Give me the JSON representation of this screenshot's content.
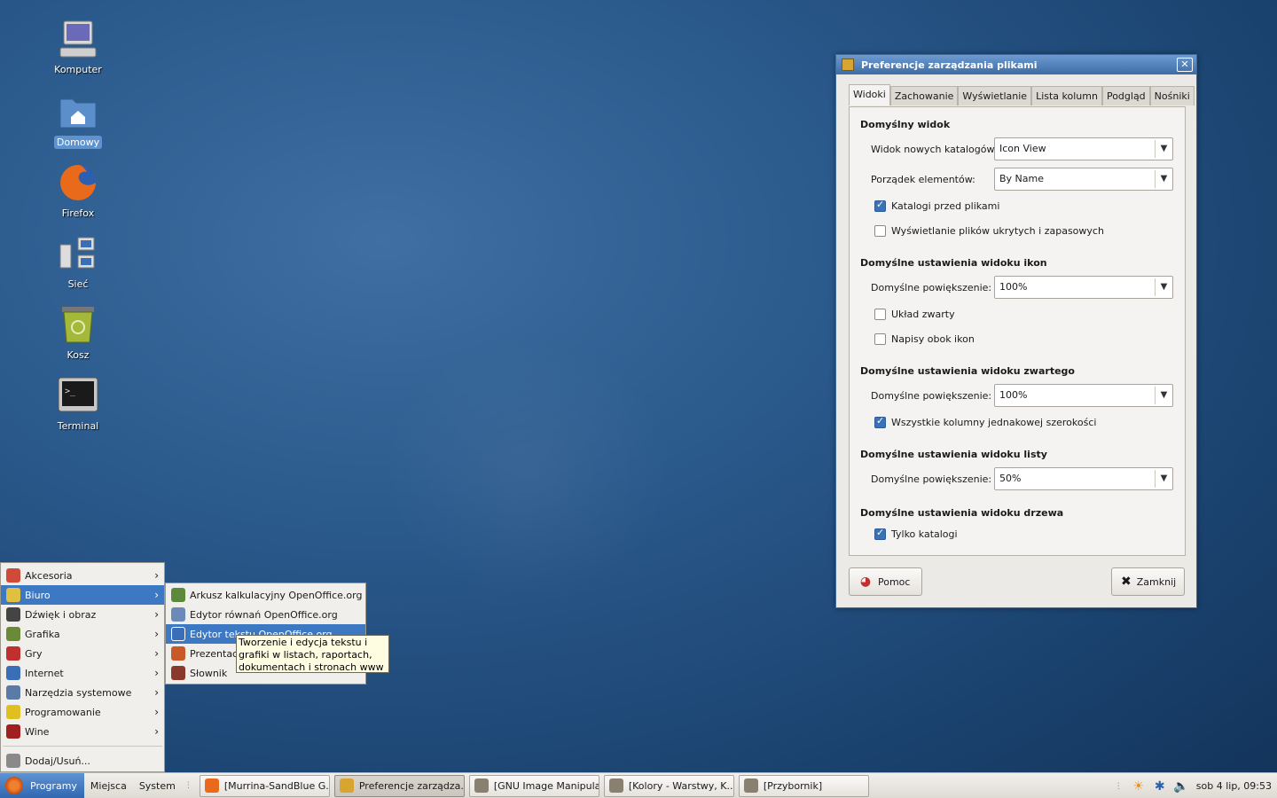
{
  "desktop": {
    "icons": [
      {
        "label": "Komputer",
        "icon": "computer-icon"
      },
      {
        "label": "Domowy",
        "icon": "home-folder-icon"
      },
      {
        "label": "Firefox",
        "icon": "firefox-icon"
      },
      {
        "label": "Sieć",
        "icon": "network-icon"
      },
      {
        "label": "Kosz",
        "icon": "trash-icon"
      },
      {
        "label": "Terminal",
        "icon": "terminal-icon"
      }
    ]
  },
  "dialog": {
    "title": "Preferencje zarządzania plikami",
    "close_glyph": "✕",
    "tabs": [
      "Widoki",
      "Zachowanie",
      "Wyświetlanie",
      "Lista kolumn",
      "Podgląd",
      "Nośniki"
    ],
    "active_tab": "Widoki",
    "sections": {
      "default_view": {
        "heading": "Domyślny widok",
        "new_folders_label": "Widok nowych katalogów:",
        "new_folders_value": "Icon View",
        "order_label": "Porządek elementów:",
        "order_value": "By Name",
        "folders_first_label": "Katalogi przed plikami",
        "folders_first_checked": true,
        "show_hidden_label": "Wyświetlanie plików ukrytych i zapasowych",
        "show_hidden_checked": false
      },
      "icon_view": {
        "heading": "Domyślne ustawienia widoku ikon",
        "zoom_label": "Domyślne powiększenie:",
        "zoom_value": "100%",
        "compact_label": "Układ zwarty",
        "compact_checked": false,
        "text_beside_label": "Napisy obok ikon",
        "text_beside_checked": false
      },
      "compact_view": {
        "heading": "Domyślne ustawienia widoku zwartego",
        "zoom_label": "Domyślne powiększenie:",
        "zoom_value": "100%",
        "same_width_label": "Wszystkie kolumny jednakowej szerokości",
        "same_width_checked": true
      },
      "list_view": {
        "heading": "Domyślne ustawienia widoku listy",
        "zoom_label": "Domyślne powiększenie:",
        "zoom_value": "50%"
      },
      "tree_view": {
        "heading": "Domyślne ustawienia widoku drzewa",
        "only_folders_label": "Tylko katalogi",
        "only_folders_checked": true
      }
    },
    "help_label": "Pomoc",
    "close_label": "Zamknij"
  },
  "menu": {
    "categories": [
      {
        "label": "Akcesoria",
        "icon": "accessories-icon",
        "color": "#d04a3a"
      },
      {
        "label": "Biuro",
        "icon": "office-icon",
        "color": "#e0c040"
      },
      {
        "label": "Dźwięk i obraz",
        "icon": "multimedia-icon",
        "color": "#444444"
      },
      {
        "label": "Grafika",
        "icon": "graphics-icon",
        "color": "#6a8a3a"
      },
      {
        "label": "Gry",
        "icon": "games-icon",
        "color": "#c03030"
      },
      {
        "label": "Internet",
        "icon": "internet-icon",
        "color": "#3a6fb8"
      },
      {
        "label": "Narzędzia systemowe",
        "icon": "system-tools-icon",
        "color": "#5a7aa8"
      },
      {
        "label": "Programowanie",
        "icon": "programming-icon",
        "color": "#e0c020"
      },
      {
        "label": "Wine",
        "icon": "wine-icon",
        "color": "#a02020"
      }
    ],
    "add_remove": "Dodaj/Usuń...",
    "submenu": [
      {
        "label": "Arkusz kalkulacyjny OpenOffice.org",
        "icon": "spreadsheet-icon"
      },
      {
        "label": "Edytor równań OpenOffice.org",
        "icon": "math-editor-icon"
      },
      {
        "label": "Edytor tekstu OpenOffice.org",
        "icon": "writer-icon"
      },
      {
        "label": "Prezentacja",
        "icon": "presentation-icon"
      },
      {
        "label": "Słownik",
        "icon": "dictionary-icon"
      }
    ],
    "tooltip": "Tworzenie i edycja tekstu i grafiki w listach, raportach, dokumentach i stronach www"
  },
  "taskbar": {
    "start_label": "Programy",
    "places_label": "Miejsca",
    "system_label": "System",
    "windows": [
      {
        "label": "[Murrina-SandBlue G...",
        "icon": "firefox-icon"
      },
      {
        "label": "Preferencje zarządza...",
        "icon": "file-manager-icon"
      },
      {
        "label": "[GNU Image Manipula...",
        "icon": "gimp-icon"
      },
      {
        "label": "[Kolory - Warstwy, K...",
        "icon": "gimp-icon"
      },
      {
        "label": "[Przybornik]",
        "icon": "gimp-icon"
      }
    ],
    "clock": "sob  4 lip, 09:53"
  }
}
